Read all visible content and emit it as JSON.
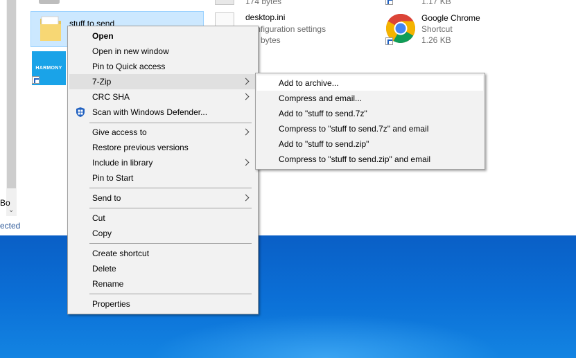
{
  "explorer": {
    "left_pane": {
      "label_fragment": "Bo",
      "status_fragment": "ected"
    },
    "files": [
      {
        "name": "stuff to send",
        "type": "folder",
        "selected": true
      },
      {
        "name": "HARMONY",
        "type": "shortcut"
      },
      {
        "name": "",
        "meta": "174 bytes",
        "type": "file"
      },
      {
        "name": "desktop.ini",
        "meta1": "Configuration settings",
        "meta2": "bytes",
        "type": "file"
      },
      {
        "name": "",
        "meta": "1.17 KB",
        "type": "file"
      },
      {
        "name": "Google Chrome",
        "meta1": "Shortcut",
        "meta2": "1.26 KB",
        "type": "shortcut"
      }
    ]
  },
  "context_menu": {
    "items": [
      {
        "label": "Open",
        "bold": true
      },
      {
        "label": "Open in new window"
      },
      {
        "label": "Pin to Quick access"
      },
      {
        "label": "7-Zip",
        "submenu": true,
        "active": true
      },
      {
        "label": "CRC SHA",
        "submenu": true
      },
      {
        "label": "Scan with Windows Defender...",
        "icon": "windows-defender-icon"
      },
      {
        "label": "Give access to",
        "submenu": true
      },
      {
        "label": "Restore previous versions"
      },
      {
        "label": "Include in library",
        "submenu": true
      },
      {
        "label": "Pin to Start"
      },
      {
        "label": "Send to",
        "submenu": true
      },
      {
        "label": "Cut"
      },
      {
        "label": "Copy"
      },
      {
        "label": "Create shortcut"
      },
      {
        "label": "Delete"
      },
      {
        "label": "Rename"
      },
      {
        "label": "Properties"
      }
    ]
  },
  "submenu_7zip": {
    "items": [
      {
        "label": "Add to archive...",
        "highlight": true
      },
      {
        "label": "Compress and email..."
      },
      {
        "label": "Add to \"stuff to send.7z\""
      },
      {
        "label": "Compress to \"stuff to send.7z\" and email"
      },
      {
        "label": "Add to \"stuff to send.zip\""
      },
      {
        "label": "Compress to \"stuff to send.zip\" and email"
      }
    ]
  },
  "colors": {
    "selection_bg": "#cce8ff",
    "menu_bg": "#f2f2f2",
    "menu_hover": "#e0e0e0",
    "desktop_blue": "#0b6fd6"
  }
}
